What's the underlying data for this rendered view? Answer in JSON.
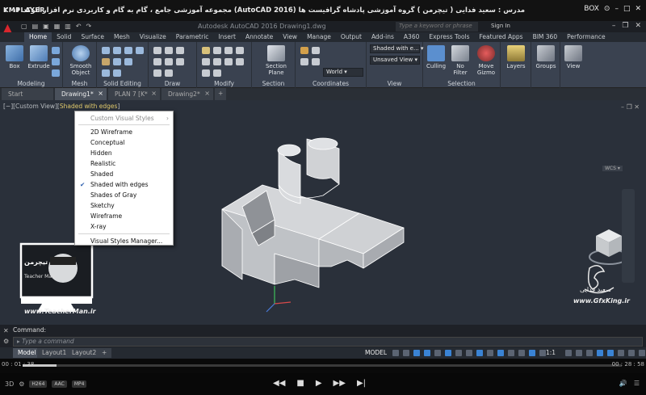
{
  "player": {
    "logo": "KMPLAYER",
    "title": "مجموعه آموزشی جامع ، گام به گام و کاربردی نرم افزار اتوکد ۲۰۱۶ (AutoCAD 2016) مدرس : سعید فدایی ( تیچرمن ) گروه آموزشی پادشاه گرافیست ها",
    "box_label": "BOX",
    "time_current": "00 : 01 : 38",
    "time_total": "00 : 28 : 58",
    "progress": 0.056,
    "badges": [
      "H264",
      "AAC",
      "MP4"
    ],
    "ctrl_play": "▶",
    "ctrl_prev": "◀◀",
    "ctrl_stop": "■",
    "ctrl_next": "▶▶",
    "ctrl_end": "▶|"
  },
  "acad": {
    "title": "Autodesk AutoCAD 2016   Drawing1.dwg",
    "search_placeholder": "Type a keyword or phrase",
    "signin": "Sign In"
  },
  "ribbon": {
    "tabs": [
      "Home",
      "Solid",
      "Surface",
      "Mesh",
      "Visualize",
      "Parametric",
      "Insert",
      "Annotate",
      "View",
      "Manage",
      "Output",
      "Add-ins",
      "A360",
      "Express Tools",
      "Featured Apps",
      "BIM 360",
      "Performance"
    ],
    "active_tab": "Home",
    "panels": {
      "modeling": "Modeling",
      "mesh": "Mesh",
      "solid_editing": "Solid Editing",
      "draw": "Draw",
      "modify": "Modify",
      "section": "Section",
      "coordinates": "Coordinates",
      "view": "View",
      "selection": "Selection"
    },
    "tools": {
      "box": "Box",
      "extrude": "Extrude",
      "smooth_object": "Smooth Object",
      "section_plane": "Section Plane",
      "culling": "Culling",
      "no_filter": "No Filter",
      "move_gizmo": "Move Gizmo",
      "layers": "Layers",
      "groups": "Groups",
      "view": "View"
    },
    "dropdowns": {
      "visual_style": "Shaded with e...",
      "saved_view": "Unsaved View",
      "ucs": "World"
    }
  },
  "doc_tabs": [
    "Start",
    "Drawing1*",
    "PLAN 7 [K*",
    "Drawing2*"
  ],
  "active_doc_tab": "Drawing1*",
  "viewport": {
    "label_prefix": "[−][Custom View][",
    "label_style": "Shaded with edges",
    "label_suffix": "]",
    "wcs": "WCS ▾"
  },
  "context_menu": {
    "header": "Custom Visual Styles",
    "items": [
      "2D Wireframe",
      "Conceptual",
      "Hidden",
      "Realistic",
      "Shaded",
      "Shaded with edges",
      "Shades of Gray",
      "Sketchy",
      "Wireframe",
      "X-ray"
    ],
    "checked": "Shaded with edges",
    "manager": "Visual Styles Manager..."
  },
  "command": {
    "history": "Command:",
    "placeholder": "Type a command"
  },
  "status": {
    "layouts": [
      "Model",
      "Layout1",
      "Layout2"
    ],
    "active_layout": "Model",
    "model_label": "MODEL",
    "scale": "1:1"
  },
  "watermarks": {
    "teacher_site": "www.TeacherMan.ir",
    "teacher_name": "تیچرمن",
    "teacher_sub": "Teacher Man",
    "gfx_site": "www.GfxKing.ir",
    "gfx_name": "سعید فدایی"
  },
  "colors": {
    "viewport_bg": "#2a303a",
    "ribbon_bg": "#3a4250",
    "solid_face": "#c9cbce",
    "accent_red": "#d9262d"
  }
}
